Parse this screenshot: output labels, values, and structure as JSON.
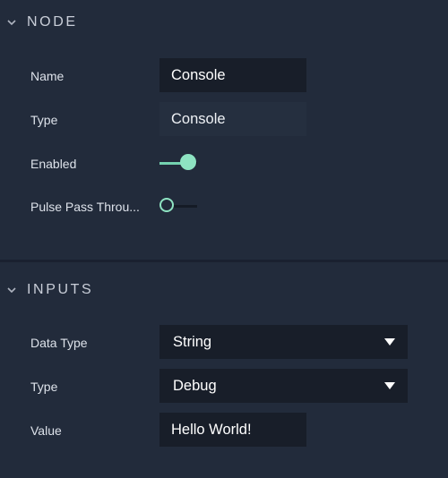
{
  "sections": {
    "node": {
      "title": "NODE",
      "rows": {
        "name": {
          "label": "Name",
          "value": "Console"
        },
        "type": {
          "label": "Type",
          "value": "Console"
        },
        "enabled": {
          "label": "Enabled",
          "checked": true
        },
        "pulse_pass_through": {
          "label": "Pulse Pass Throu...",
          "checked": false
        }
      }
    },
    "inputs": {
      "title": "INPUTS",
      "rows": {
        "data_type": {
          "label": "Data Type",
          "value": "String"
        },
        "type": {
          "label": "Type",
          "value": "Debug"
        },
        "value": {
          "label": "Value",
          "value": "Hello World!"
        }
      }
    }
  },
  "colors": {
    "background": "#222b3b",
    "field_background": "#181e29",
    "readonly_background": "#252f3f",
    "accent": "#8ee3c2"
  },
  "icons": {
    "section_toggle": "chevron-down-icon",
    "dropdown": "caret-down-icon"
  }
}
